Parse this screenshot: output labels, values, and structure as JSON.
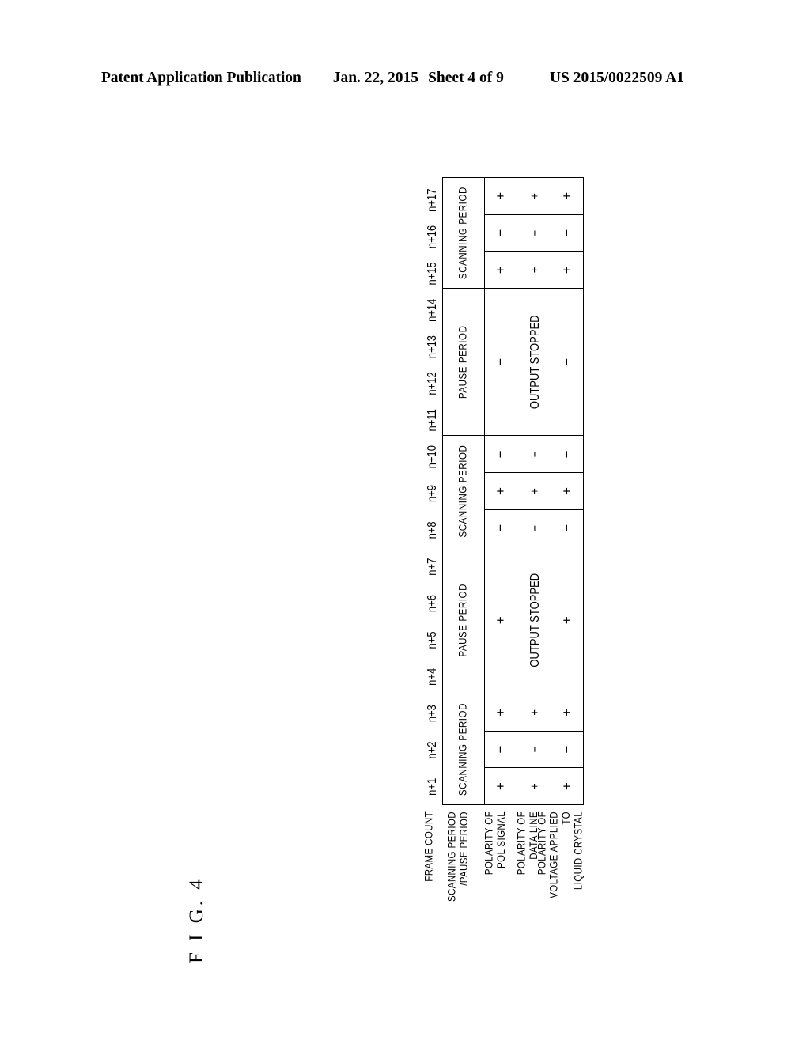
{
  "header": {
    "publication": "Patent Application Publication",
    "date": "Jan. 22, 2015",
    "sheet": "Sheet 4 of 9",
    "patent_number": "US 2015/0022509 A1"
  },
  "figure": {
    "label": "F I G.  4"
  },
  "table": {
    "row_labels": [
      "FRAME COUNT",
      "SCANNING PERIOD\n/PAUSE PERIOD",
      "POLARITY OF\nPOL SIGNAL",
      "POLARITY OF\nDATA LINE",
      "POLARITY OF\nVOLTAGE APPLIED TO\nLIQUID CRYSTAL"
    ],
    "frame_counts": [
      "n+1",
      "n+2",
      "n+3",
      "n+4",
      "n+5",
      "n+6",
      "n+7",
      "n+8",
      "n+9",
      "n+10",
      "n+11",
      "n+12",
      "n+13",
      "n+14",
      "n+15",
      "n+16",
      "n+17"
    ],
    "period_row": [
      {
        "label": "SCANNING PERIOD",
        "span": 3,
        "hatched": false
      },
      {
        "label": "PAUSE PERIOD",
        "span": 4,
        "hatched": true
      },
      {
        "label": "SCANNING PERIOD",
        "span": 3,
        "hatched": false
      },
      {
        "label": "PAUSE PERIOD",
        "span": 4,
        "hatched": true
      },
      {
        "label": "SCANNING PERIOD",
        "span": 3,
        "hatched": false
      }
    ],
    "pol_signal_row": [
      {
        "label": "+",
        "span": 1,
        "hatched": false
      },
      {
        "label": "−",
        "span": 1,
        "hatched": false
      },
      {
        "label": "+",
        "span": 1,
        "hatched": false
      },
      {
        "label": "+",
        "span": 4,
        "hatched": false
      },
      {
        "label": "−",
        "span": 1,
        "hatched": false
      },
      {
        "label": "+",
        "span": 1,
        "hatched": false
      },
      {
        "label": "−",
        "span": 1,
        "hatched": false
      },
      {
        "label": "−",
        "span": 4,
        "hatched": false
      },
      {
        "label": "+",
        "span": 1,
        "hatched": false
      },
      {
        "label": "−",
        "span": 1,
        "hatched": false
      },
      {
        "label": "+",
        "span": 1,
        "hatched": false
      }
    ],
    "data_line_row": [
      {
        "label": "+",
        "span": 1,
        "hatched": false
      },
      {
        "label": "−",
        "span": 1,
        "hatched": false
      },
      {
        "label": "+",
        "span": 1,
        "hatched": false
      },
      {
        "label": "OUTPUT STOPPED",
        "span": 4,
        "hatched": true
      },
      {
        "label": "−",
        "span": 1,
        "hatched": false
      },
      {
        "label": "+",
        "span": 1,
        "hatched": false
      },
      {
        "label": "−",
        "span": 1,
        "hatched": false
      },
      {
        "label": "OUTPUT STOPPED",
        "span": 4,
        "hatched": true
      },
      {
        "label": "+",
        "span": 1,
        "hatched": false
      },
      {
        "label": "−",
        "span": 1,
        "hatched": false
      },
      {
        "label": "+",
        "span": 1,
        "hatched": false
      }
    ],
    "liquid_crystal_row": [
      {
        "label": "+",
        "span": 1,
        "hatched": false
      },
      {
        "label": "−",
        "span": 1,
        "hatched": false
      },
      {
        "label": "+",
        "span": 1,
        "hatched": false
      },
      {
        "label": "+",
        "span": 4,
        "hatched": false
      },
      {
        "label": "−",
        "span": 1,
        "hatched": false
      },
      {
        "label": "+",
        "span": 1,
        "hatched": false
      },
      {
        "label": "−",
        "span": 1,
        "hatched": false
      },
      {
        "label": "−",
        "span": 4,
        "hatched": false
      },
      {
        "label": "+",
        "span": 1,
        "hatched": false
      },
      {
        "label": "−",
        "span": 1,
        "hatched": false
      },
      {
        "label": "+",
        "span": 1,
        "hatched": false
      }
    ]
  },
  "colors": {
    "ink": "#000000",
    "paper": "#ffffff"
  }
}
